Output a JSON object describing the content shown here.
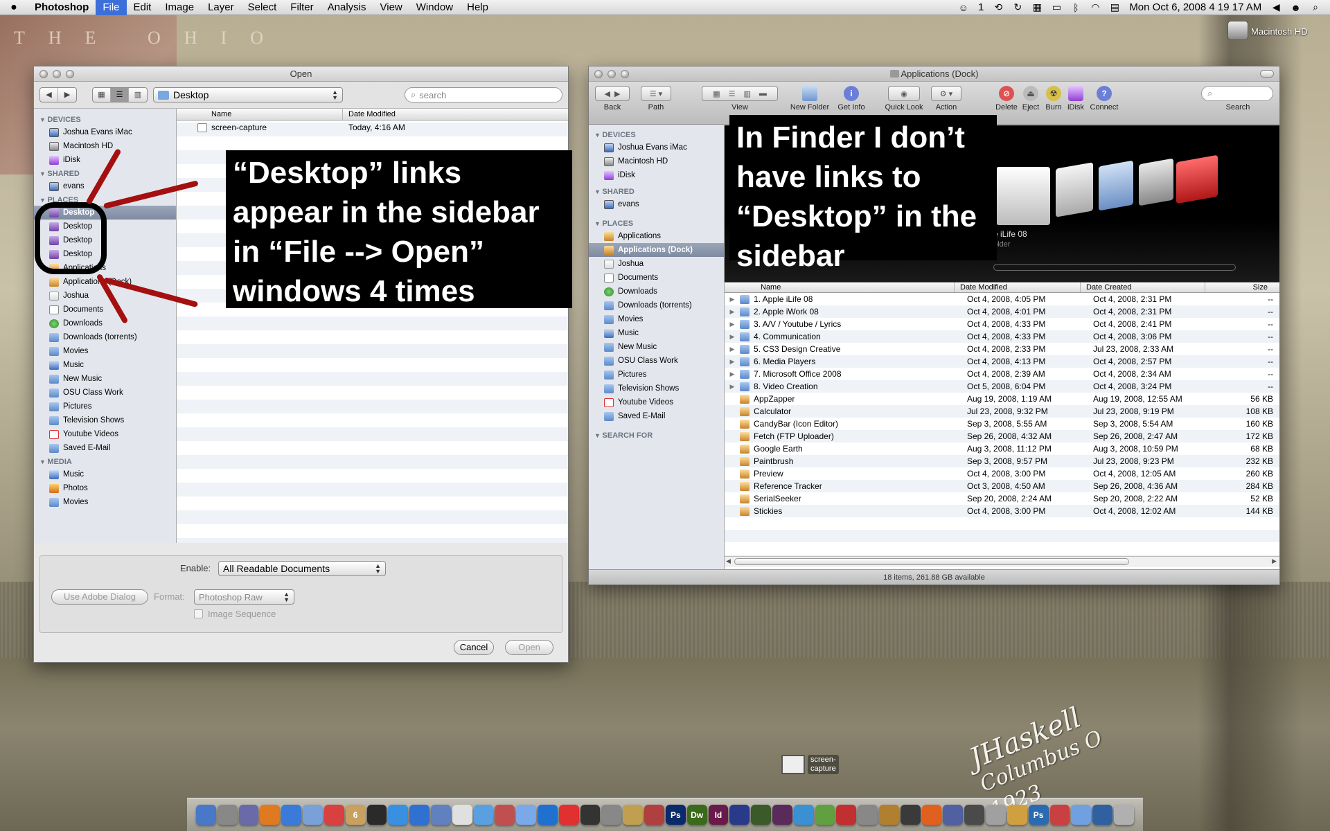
{
  "menubar": {
    "app": "Photoshop",
    "menus": [
      "File",
      "Edit",
      "Image",
      "Layer",
      "Select",
      "Filter",
      "Analysis",
      "View",
      "Window",
      "Help"
    ],
    "active_menu": "File",
    "status_count": "1",
    "clock": "Mon  Oct 6, 2008  4 19 17 AM"
  },
  "desktop": {
    "hd_label": "Macintosh HD",
    "file_label_1": "screen-",
    "file_label_2": "capture",
    "signature_1": "JHaskell",
    "signature_2": "Columbus O",
    "signature_3": "1923"
  },
  "open_dialog": {
    "title": "Open",
    "location": "Desktop",
    "search_placeholder": "search",
    "sidebar": {
      "devices_heading": "DEVICES",
      "devices": [
        "Joshua Evans iMac",
        "Macintosh HD",
        "iDisk"
      ],
      "shared_heading": "SHARED",
      "shared": [
        "evans"
      ],
      "places_heading": "PLACES",
      "places": [
        "Desktop",
        "Desktop",
        "Desktop",
        "Desktop",
        "Applications",
        "Applications (Dock)",
        "Joshua",
        "Documents",
        "Downloads",
        "Downloads (torrents)",
        "Movies",
        "Music",
        "New Music",
        "OSU Class Work",
        "Pictures",
        "Television Shows",
        "Youtube Videos",
        "Saved E-Mail"
      ],
      "media_heading": "MEDIA",
      "media": [
        "Music",
        "Photos",
        "Movies"
      ]
    },
    "columns": {
      "name": "Name",
      "date": "Date Modified"
    },
    "files": [
      {
        "name": "screen-capture",
        "date": "Today, 4:16 AM"
      }
    ],
    "enable_label": "Enable:",
    "enable_value": "All Readable Documents",
    "adobe_dialog_button": "Use Adobe Dialog",
    "format_label": "Format:",
    "format_value": "Photoshop Raw",
    "image_sequence": "Image Sequence",
    "cancel": "Cancel",
    "open": "Open"
  },
  "callouts": {
    "left": "“Desktop” links\nappear in the sidebar\nin “File --> Open”\nwindows 4 times",
    "right": "In Finder I don’t\nhave links to\n“Desktop” in the\nsidebar"
  },
  "finder": {
    "title": "Applications (Dock)",
    "toolbar": {
      "back": "Back",
      "path": "Path",
      "view": "View",
      "new_folder": "New Folder",
      "get_info": "Get Info",
      "quick_look": "Quick Look",
      "action": "Action",
      "delete": "Delete",
      "eject": "Eject",
      "burn": "Burn",
      "idisk": "iDisk",
      "connect": "Connect",
      "search": "Search"
    },
    "sidebar": {
      "devices_heading": "DEVICES",
      "devices": [
        "Joshua Evans iMac",
        "Macintosh HD",
        "iDisk"
      ],
      "shared_heading": "SHARED",
      "shared": [
        "evans"
      ],
      "places_heading": "PLACES",
      "places": [
        "Applications",
        "Applications (Dock)",
        "Joshua",
        "Documents",
        "Downloads",
        "Downloads (torrents)",
        "Movies",
        "Music",
        "New Music",
        "OSU Class Work",
        "Pictures",
        "Television Shows",
        "Youtube Videos",
        "Saved E-Mail"
      ],
      "search_heading": "SEARCH FOR"
    },
    "coverflow": {
      "label": "e iLife 08",
      "sub": "older"
    },
    "columns": {
      "name": "Name",
      "modified": "Date Modified",
      "created": "Date Created",
      "size": "Size"
    },
    "rows": [
      {
        "name": "1. Apple iLife 08",
        "modified": "Oct 4, 2008, 4:05 PM",
        "created": "Oct 4, 2008, 2:31 PM",
        "size": "--",
        "folder": true
      },
      {
        "name": "2. Apple iWork 08",
        "modified": "Oct 4, 2008, 4:01 PM",
        "created": "Oct 4, 2008, 2:31 PM",
        "size": "--",
        "folder": true
      },
      {
        "name": "3. A/V / Youtube / Lyrics",
        "modified": "Oct 4, 2008, 4:33 PM",
        "created": "Oct 4, 2008, 2:41 PM",
        "size": "--",
        "folder": true
      },
      {
        "name": "4. Communication",
        "modified": "Oct 4, 2008, 4:33 PM",
        "created": "Oct 4, 2008, 3:06 PM",
        "size": "--",
        "folder": true
      },
      {
        "name": "5. CS3 Design Creative",
        "modified": "Oct 4, 2008, 2:33 PM",
        "created": "Jul 23, 2008, 2:33 AM",
        "size": "--",
        "folder": true
      },
      {
        "name": "6. Media Players",
        "modified": "Oct 4, 2008, 4:13 PM",
        "created": "Oct 4, 2008, 2:57 PM",
        "size": "--",
        "folder": true
      },
      {
        "name": "7. Microsoft Office 2008",
        "modified": "Oct 4, 2008, 2:39 AM",
        "created": "Oct 4, 2008, 2:34 AM",
        "size": "--",
        "folder": true
      },
      {
        "name": "8. Video Creation",
        "modified": "Oct 5, 2008, 6:04 PM",
        "created": "Oct 4, 2008, 3:24 PM",
        "size": "--",
        "folder": true
      },
      {
        "name": "AppZapper",
        "modified": "Aug 19, 2008, 1:19 AM",
        "created": "Aug 19, 2008, 12:55 AM",
        "size": "56 KB",
        "folder": false
      },
      {
        "name": "Calculator",
        "modified": "Jul 23, 2008, 9:32 PM",
        "created": "Jul 23, 2008, 9:19 PM",
        "size": "108 KB",
        "folder": false
      },
      {
        "name": "CandyBar (Icon Editor)",
        "modified": "Sep 3, 2008, 5:55 AM",
        "created": "Sep 3, 2008, 5:54 AM",
        "size": "160 KB",
        "folder": false
      },
      {
        "name": "Fetch (FTP Uploader)",
        "modified": "Sep 26, 2008, 4:32 AM",
        "created": "Sep 26, 2008, 2:47 AM",
        "size": "172 KB",
        "folder": false
      },
      {
        "name": "Google Earth",
        "modified": "Aug 3, 2008, 11:12 PM",
        "created": "Aug 3, 2008, 10:59 PM",
        "size": "68 KB",
        "folder": false
      },
      {
        "name": "Paintbrush",
        "modified": "Sep 3, 2008, 9:57 PM",
        "created": "Jul 23, 2008, 9:23 PM",
        "size": "232 KB",
        "folder": false
      },
      {
        "name": "Preview",
        "modified": "Oct 4, 2008, 3:00 PM",
        "created": "Oct 4, 2008, 12:05 AM",
        "size": "260 KB",
        "folder": false
      },
      {
        "name": "Reference Tracker",
        "modified": "Oct 3, 2008, 4:50 AM",
        "created": "Sep 26, 2008, 4:36 AM",
        "size": "284 KB",
        "folder": false
      },
      {
        "name": "SerialSeeker",
        "modified": "Sep 20, 2008, 2:24 AM",
        "created": "Sep 20, 2008, 2:22 AM",
        "size": "52 KB",
        "folder": false
      },
      {
        "name": "Stickies",
        "modified": "Oct 4, 2008, 3:00 PM",
        "created": "Oct 4, 2008, 12:02 AM",
        "size": "144 KB",
        "folder": false
      }
    ],
    "status": "18 items, 261.88 GB available"
  },
  "dock": {
    "labels": [
      "Ps",
      "Dw",
      "Id",
      "Ps"
    ],
    "calendar_day": "6"
  },
  "colors": {
    "menu_highlight": "#3d6fd9",
    "sidebar_bg": "#e3e7ed",
    "selection": "#7e8aa0",
    "annotation_red": "#a40f0f",
    "callout_bg": "#000000"
  }
}
